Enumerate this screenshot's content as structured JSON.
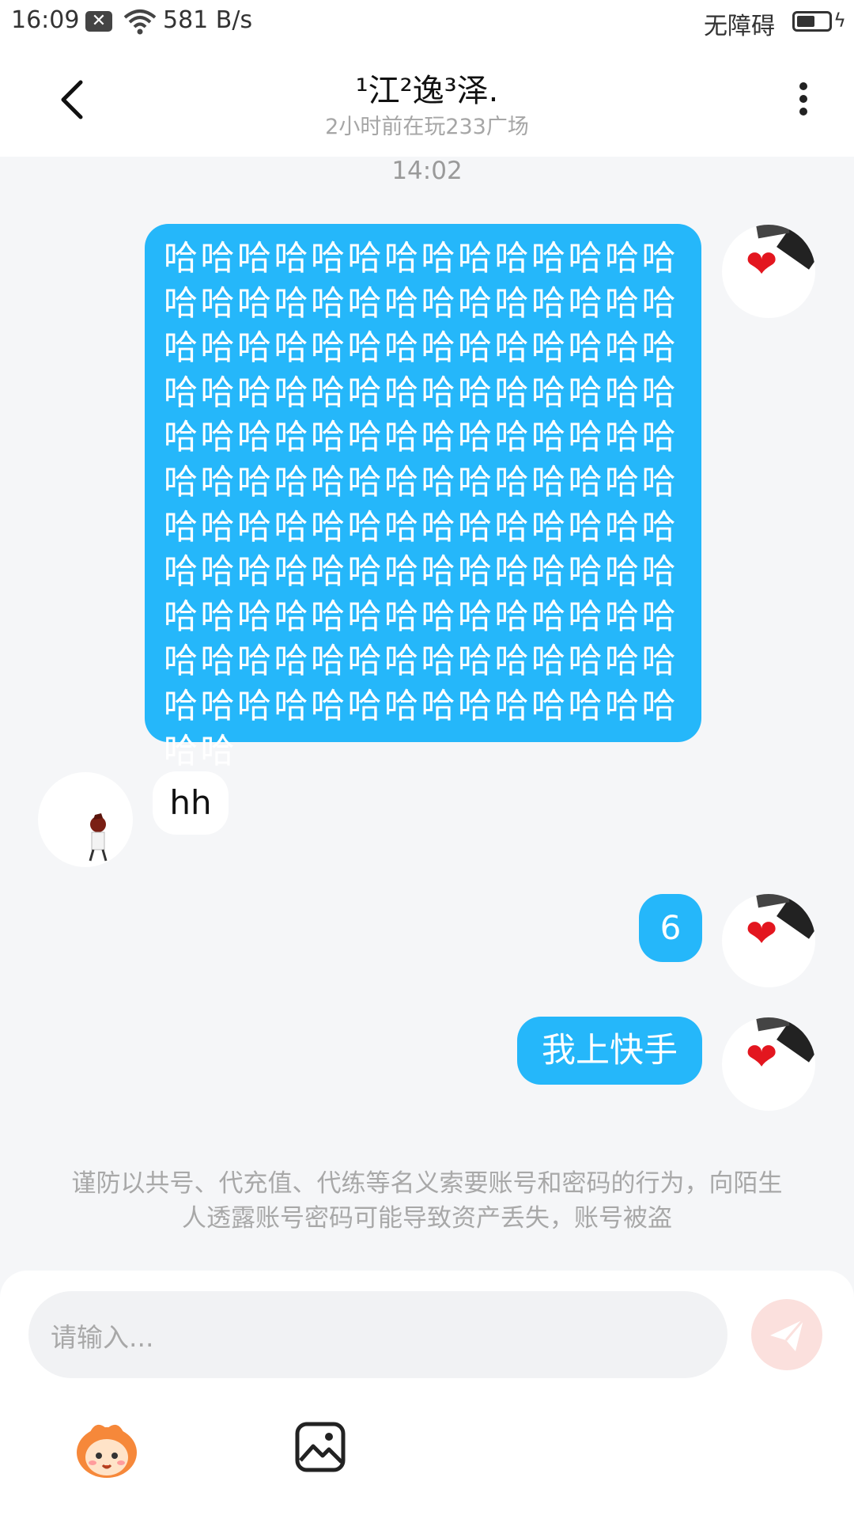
{
  "status_bar": {
    "time": "16:09",
    "notification_icon": "close-notification-icon",
    "wifi_icon": "wifi-icon",
    "net_speed": "581 B/s",
    "accessibility": "无障碍",
    "battery_icon": "battery-charging-icon"
  },
  "header": {
    "back_icon": "chevron-left-icon",
    "title": "¹江²逸³泽.",
    "subtitle": "2小时前在玩233广场",
    "more_icon": "more-vertical-icon"
  },
  "chat": {
    "timestamp": "14:02",
    "messages": [
      {
        "direction": "out",
        "text": "哈哈哈哈哈哈哈哈哈哈哈哈哈哈哈哈哈哈哈哈哈哈哈哈哈哈哈哈哈哈哈哈哈哈哈哈哈哈哈哈哈哈哈哈哈哈哈哈哈哈哈哈哈哈哈哈哈哈哈哈哈哈哈哈哈哈哈哈哈哈哈哈哈哈哈哈哈哈哈哈哈哈哈哈哈哈哈哈哈哈哈哈哈哈哈哈哈哈哈哈哈哈哈哈哈哈哈哈哈哈哈哈哈哈哈哈哈哈哈哈哈哈哈哈哈哈哈哈哈哈哈哈哈哈哈哈哈哈哈哈哈哈哈哈哈哈哈哈哈哈哈哈哈哈哈哈"
      },
      {
        "direction": "in",
        "text": "hh"
      },
      {
        "direction": "out",
        "text": "6"
      },
      {
        "direction": "out",
        "text": "我上快手"
      }
    ],
    "notice": "谨防以共号、代充值、代练等名义索要账号和密码的行为，向陌生人透露账号密码可能导致资产丢失，账号被盗"
  },
  "composer": {
    "placeholder": "请输入...",
    "send_icon": "paper-plane-icon",
    "emoji_icon": "emoji-mascot-icon",
    "image_icon": "image-icon"
  },
  "colors": {
    "outgoing_bubble": "#25b7fa",
    "send_button_disabled": "#fbe0dd",
    "heart": "#e3161f"
  }
}
